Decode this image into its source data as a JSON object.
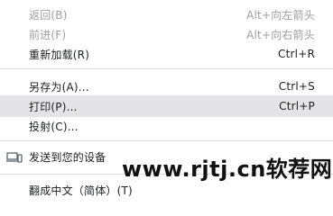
{
  "menu": {
    "back": {
      "label": "返回(B)",
      "shortcut": "Alt+向左箭头"
    },
    "forward": {
      "label": "前进(F)",
      "shortcut": "Alt+向右箭头"
    },
    "reload": {
      "label": "重新加载(R)",
      "shortcut": "Ctrl+R"
    },
    "save_as": {
      "label": "另存为(A)...",
      "shortcut": "Ctrl+S"
    },
    "print": {
      "label": "打印(P)...",
      "shortcut": "Ctrl+P"
    },
    "cast": {
      "label": "投射(C)..."
    },
    "send_to_devices": {
      "label": "发送到您的设备",
      "icon": "devices-icon"
    },
    "translate": {
      "label": "翻成中文（简体）(T)"
    }
  },
  "watermark": {
    "text": "www.rjtj.cn软荐网"
  },
  "colors": {
    "disabled_text": "#9e9e9e",
    "highlight_bg": "#e4e4e6",
    "separator": "#dcdcdc"
  }
}
